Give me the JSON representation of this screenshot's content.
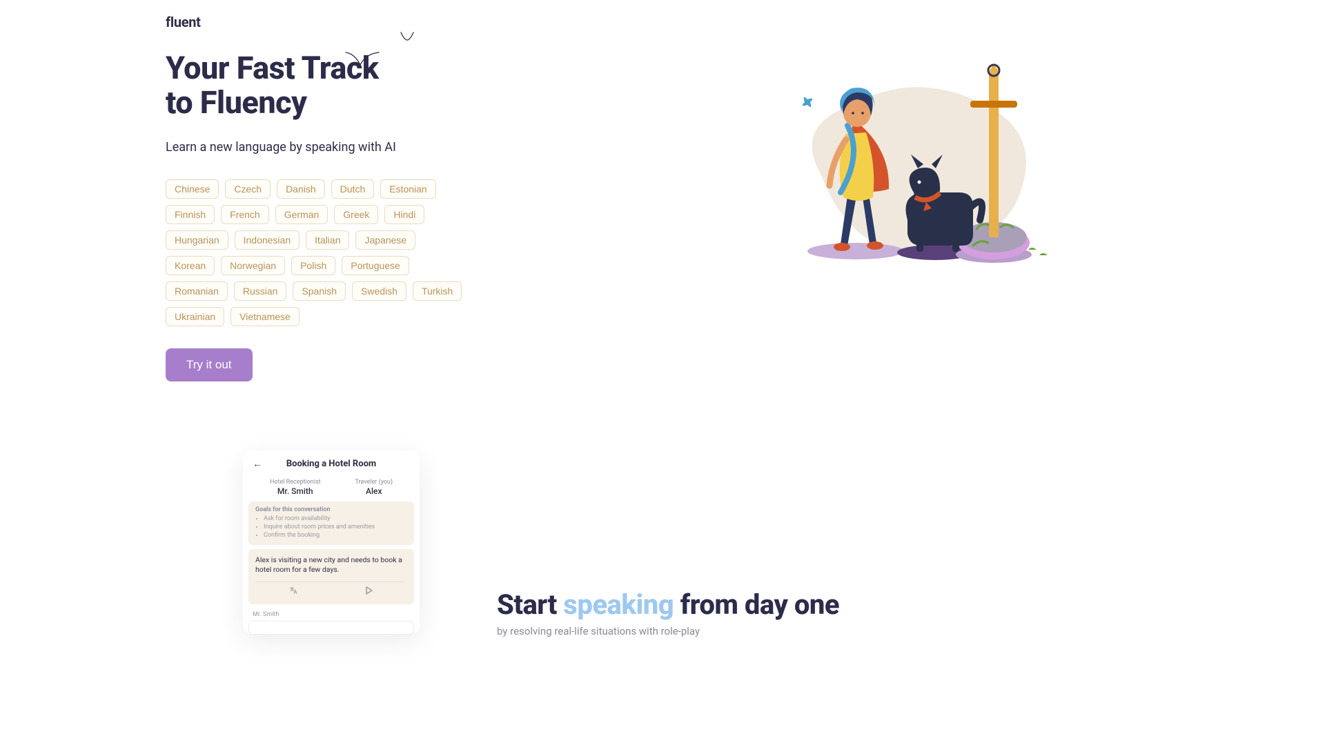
{
  "brand": {
    "logo": "fluent"
  },
  "hero": {
    "title_line1": "Your Fast Track",
    "title_line2": "to Fluency",
    "subtitle": "Learn a new language by speaking with AI",
    "cta": "Try it out",
    "languages": [
      "Chinese",
      "Czech",
      "Danish",
      "Dutch",
      "Estonian",
      "Finnish",
      "French",
      "German",
      "Greek",
      "Hindi",
      "Hungarian",
      "Indonesian",
      "Italian",
      "Japanese",
      "Korean",
      "Norwegian",
      "Polish",
      "Portuguese",
      "Romanian",
      "Russian",
      "Spanish",
      "Swedish",
      "Turkish",
      "Ukrainian",
      "Vietnamese"
    ]
  },
  "preview": {
    "title": "Booking a Hotel Room",
    "role_a_label": "Hotel Receptionist",
    "role_a_name": "Mr. Smith",
    "role_b_label": "Traveler (you)",
    "role_b_name": "Alex",
    "goals_title": "Goals for this conversation",
    "goals": [
      "Ask for room availability",
      "Inquire about room prices and amenities",
      "Confirm the booking"
    ],
    "scenario": "Alex is visiting a new city and needs to book a hotel room for a few days.",
    "from": "Mr. Smith"
  },
  "section2": {
    "title_pre": "Start ",
    "title_accent": "speaking",
    "title_post": " from day one",
    "subtitle": "by resolving real-life situations with role-play"
  },
  "colors": {
    "primary": "#a77ecb",
    "text": "#2c2c4a",
    "pill_border": "#e8dcc4",
    "pill_text": "#b8935a",
    "accent_soft": "#9dc8f0"
  }
}
